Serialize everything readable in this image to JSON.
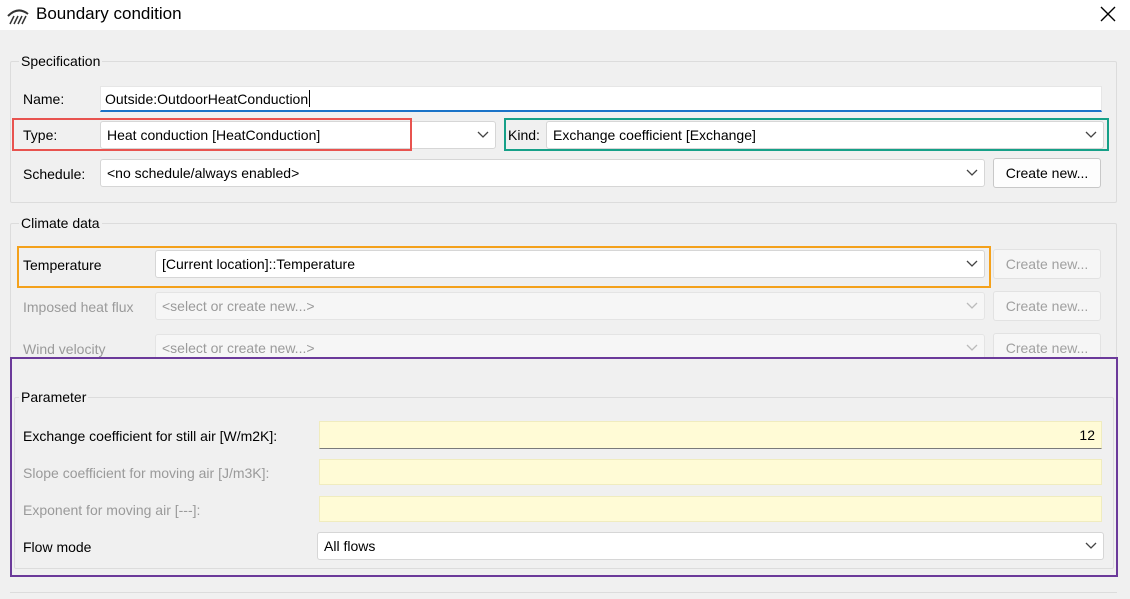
{
  "window": {
    "title": "Boundary condition",
    "icon": "boundary-condition-icon",
    "close_icon": "close-icon"
  },
  "specification": {
    "group_title": "Specification",
    "name_label": "Name:",
    "name_value": "Outside:OutdoorHeatConduction",
    "type_label": "Type:",
    "type_value": "Heat conduction [HeatConduction]",
    "kind_label": "Kind:",
    "kind_value": "Exchange coefficient [Exchange]",
    "schedule_label": "Schedule:",
    "schedule_value": "<no schedule/always enabled>",
    "create_new_label": "Create new..."
  },
  "climate": {
    "group_title": "Climate data",
    "rows": [
      {
        "label": "Temperature",
        "value": "[Current location]::Temperature",
        "button": "Create new...",
        "enabled": true
      },
      {
        "label": "Imposed heat flux",
        "value": "<select or create new...>",
        "button": "Create new...",
        "enabled": false
      },
      {
        "label": "Wind velocity",
        "value": "<select or create new...>",
        "button": "Create new...",
        "enabled": false
      }
    ]
  },
  "parameter": {
    "group_title": "Parameter",
    "rows": [
      {
        "label": "Exchange coefficient for still air [W/m2K]:",
        "value": "12",
        "enabled": true
      },
      {
        "label": "Slope coefficient for moving air [J/m3K]:",
        "value": "",
        "enabled": false
      },
      {
        "label": "Exponent for moving air [---]:",
        "value": "",
        "enabled": false
      }
    ],
    "flow_mode_label": "Flow mode",
    "flow_mode_value": "All flows"
  },
  "highlight_colors": {
    "type": "#e8534f",
    "kind": "#16a088",
    "temperature": "#f4a11b",
    "parameter": "#6b3a9a"
  }
}
